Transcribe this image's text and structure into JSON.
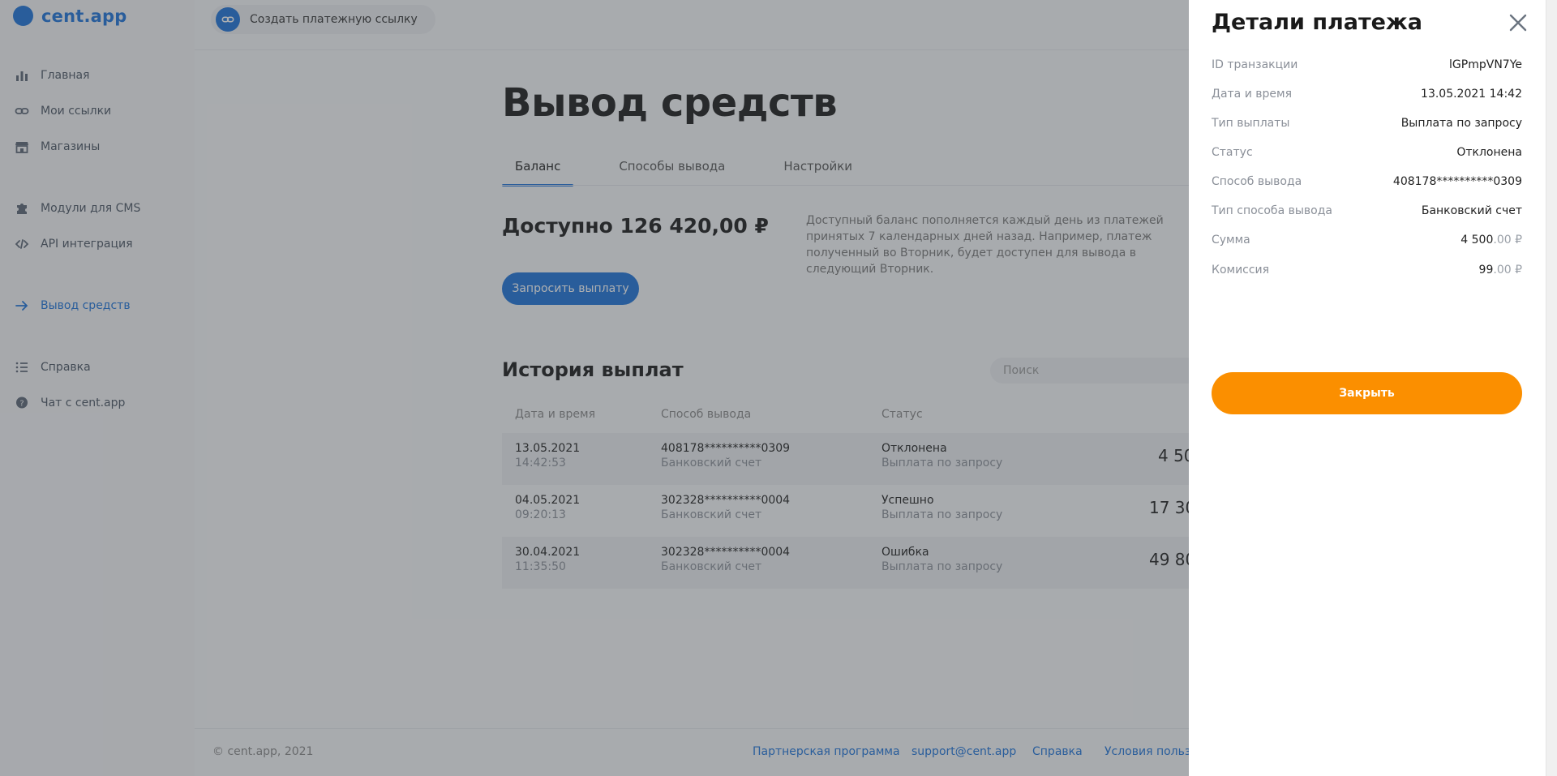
{
  "brand": {
    "name": "cent.app",
    "accent": "#1d73d9",
    "orange": "#fb8f00"
  },
  "sidebar": {
    "items": [
      {
        "label": "Главная",
        "icon": "bar-chart-icon"
      },
      {
        "label": "Мои ссылки",
        "icon": "link-icon"
      },
      {
        "label": "Магазины",
        "icon": "store-icon"
      },
      {
        "label": "Модули для CMS",
        "icon": "puzzle-icon"
      },
      {
        "label": "API интеграция",
        "icon": "code-icon"
      },
      {
        "label": "Вывод средств",
        "icon": "arrow-right-icon",
        "active": true
      },
      {
        "label": "Справка",
        "icon": "list-icon"
      },
      {
        "label": "Чат с cent.app",
        "icon": "chat-icon"
      }
    ]
  },
  "topbar": {
    "create_link": "Создать платежную ссылку"
  },
  "page": {
    "title": "Вывод средств",
    "tabs": [
      "Баланс",
      "Способы вывода",
      "Настройки"
    ],
    "available": "Доступно 126 420,00 ₽",
    "available_desc": "Доступный баланс пополняется каждый день из платежей принятых 7 календарных дней назад. Например, платеж полученный во Вторник, будет доступен для вывода в следующий Вторник.",
    "request_button": "Запросить выплату",
    "history_title": "История выплат",
    "search_placeholder": "Поиск"
  },
  "table": {
    "headers": [
      "Дата и время",
      "Способ вывода",
      "Статус"
    ],
    "rows": [
      {
        "date": "13.05.2021",
        "time": "14:42:53",
        "method": "408178**********0309",
        "method_type": "Банковский счет",
        "status": "Отклонена",
        "status_sub": "Выплата по запросу",
        "amount": "4 50"
      },
      {
        "date": "04.05.2021",
        "time": "09:20:13",
        "method": "302328**********0004",
        "method_type": "Банковский счет",
        "status": "Успешно",
        "status_sub": "Выплата по запросу",
        "amount": "17 30"
      },
      {
        "date": "30.04.2021",
        "time": "11:35:50",
        "method": "302328**********0004",
        "method_type": "Банковский счет",
        "status": "Ошибка",
        "status_sub": "Выплата по запросу",
        "amount": "49 80"
      }
    ]
  },
  "footer": {
    "copyright": "© cent.app, 2021",
    "links": [
      "Партнерская программа",
      "support@cent.app",
      "Справка",
      "Условия пользо"
    ]
  },
  "drawer": {
    "title": "Детали платежа",
    "fields": [
      {
        "label": "ID транзакции",
        "value": "lGPmpVN7Ye"
      },
      {
        "label": "Дата и время",
        "value": "13.05.2021 14:42"
      },
      {
        "label": "Тип выплаты",
        "value": "Выплата по запросу"
      },
      {
        "label": "Статус",
        "value": "Отклонена"
      },
      {
        "label": "Способ вывода",
        "value": "408178**********0309"
      },
      {
        "label": "Тип способа вывода",
        "value": "Банковский счет"
      }
    ],
    "sum": {
      "label": "Сумма",
      "int": "4 500",
      "dec": ".00 ₽"
    },
    "fee": {
      "label": "Комиссия",
      "int": "99",
      "dec": ".00 ₽"
    },
    "close_button": "Закрыть"
  }
}
